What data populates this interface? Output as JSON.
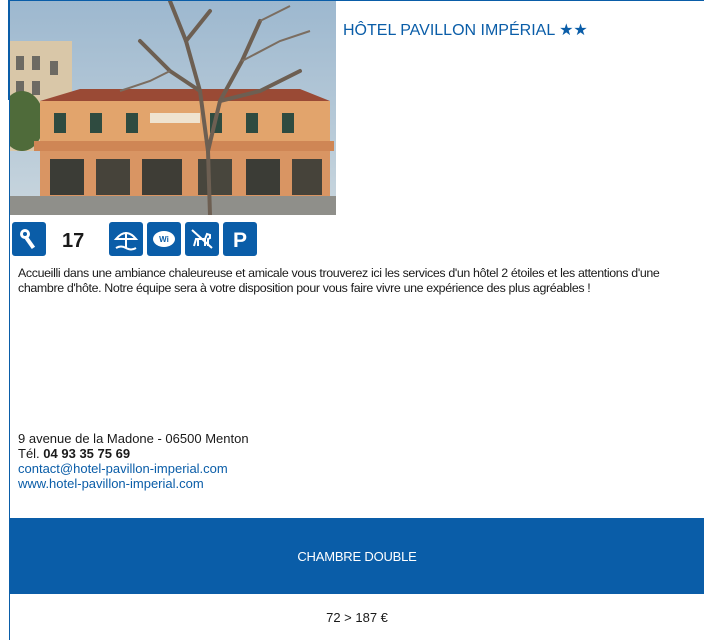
{
  "hotel": {
    "name": "HÔTEL PAVILLON IMPÉRIAL",
    "stars": "★★"
  },
  "amenities": {
    "room_count": "17",
    "icons": [
      "room-key-icon",
      "beach-umbrella-icon",
      "wifi-icon",
      "no-dogs-icon",
      "parking-icon"
    ]
  },
  "description": "Accueilli dans une ambiance chaleureuse et amicale vous trouverez ici les services d'un hôtel 2 étoiles et les attentions d'une chambre d'hôte. Notre équipe sera à votre disposition pour vous faire vivre une expérience des plus agréables !",
  "contact": {
    "address": "9 avenue de la Madone - 06500 Menton",
    "phone_label": "Tél. ",
    "phone": "04 93 35 75 69",
    "email": "contact@hotel-pavillon-imperial.com",
    "website": "www.hotel-pavillon-imperial.com"
  },
  "rates": {
    "room_type": "CHAMBRE DOUBLE",
    "price": "72 > 187 €"
  },
  "colors": {
    "accent": "#0a5da8"
  }
}
